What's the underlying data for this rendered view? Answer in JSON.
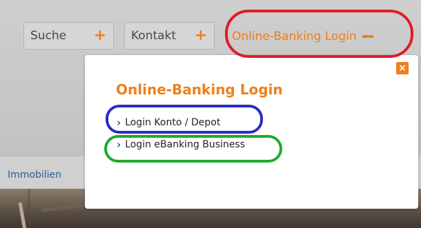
{
  "tabs": {
    "search_label": "Suche",
    "contact_label": "Kontakt",
    "login_label": "Online-Banking Login",
    "plus_icon": "+",
    "close_icon": "×"
  },
  "subnav": {
    "item_label": "Immobilien"
  },
  "popup": {
    "title": "Online-Banking Login",
    "links": [
      {
        "label": "Login Konto / Depot"
      },
      {
        "label": "Login eBanking Business"
      }
    ]
  },
  "colors": {
    "accent": "#ef7f1a",
    "link_chevron": "#1d5a9c",
    "ring_red": "#e01b24",
    "ring_blue": "#2a2ac8",
    "ring_green": "#1faa2d"
  }
}
